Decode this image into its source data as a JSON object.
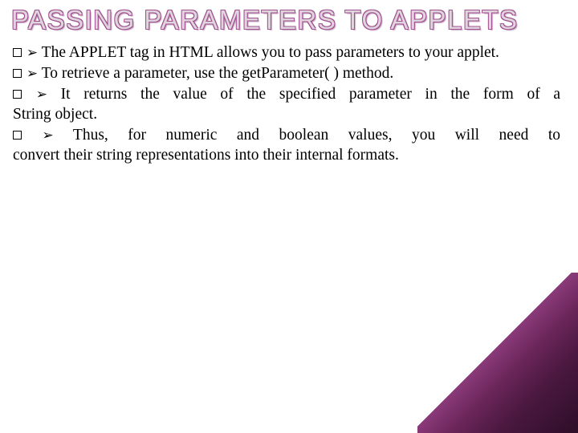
{
  "title": "PASSING PARAMETERS TO APPLETS",
  "bullets": {
    "b1": "The APPLET tag in HTML allows you to pass parameters to your applet.",
    "b2": "To retrieve a parameter, use the getParameter( ) method.",
    "b3a": "It returns the value of the specified parameter in the form of a",
    "b3b": "String object.",
    "b4a": "Thus, for numeric and boolean values, you will need to",
    "b4b": "convert their string representations into their internal formats."
  }
}
